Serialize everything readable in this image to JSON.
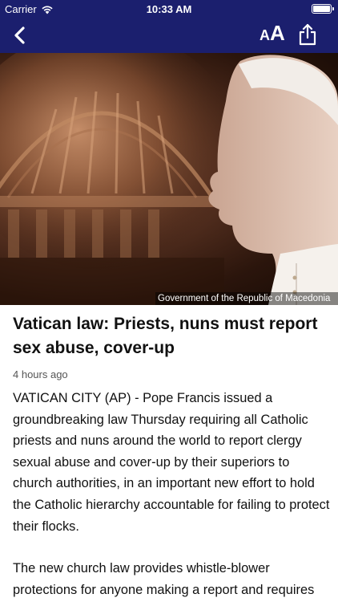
{
  "status_bar": {
    "carrier": "Carrier",
    "time": "10:33 AM",
    "battery_level": 1.0
  },
  "nav_bar": {
    "background": "#1b1f6e",
    "back_icon": "chevron-left-icon",
    "font_size_label_small": "A",
    "font_size_label_big": "A",
    "share_icon": "share-icon"
  },
  "hero_image": {
    "credit": "Government of the Republic of Macedonia"
  },
  "article": {
    "headline": "Vatican law: Priests, nuns must report sex abuse, cover-up",
    "timestamp": "4 hours ago",
    "paragraphs": [
      "VATICAN CITY (AP) - Pope Francis issued a groundbreaking law Thursday requiring all Catholic priests and nuns around the world to report clergy sexual abuse and cover-up by their superiors to church authorities, in an important new effort to hold the Catholic hierarchy accountable for failing to protect their flocks.",
      "The new church law provides whistle-blower protections for anyone making a report and requires"
    ]
  }
}
